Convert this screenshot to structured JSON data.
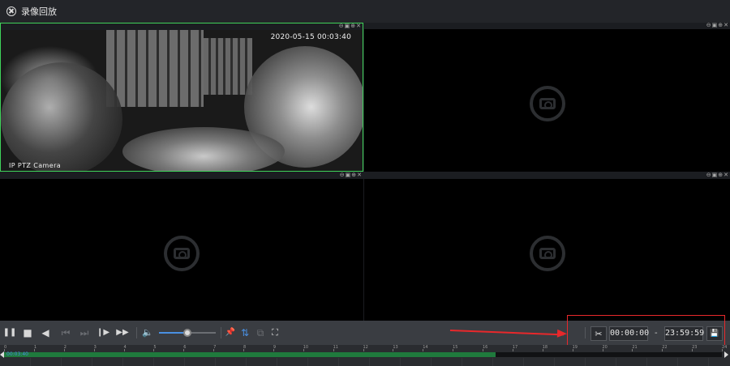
{
  "window": {
    "title": "录像回放"
  },
  "panes": [
    {
      "id": "pane-1",
      "active": true,
      "has_video": true,
      "osd_time": "2020-05-15 00:03:40",
      "osd_name": "IP PTZ Camera",
      "controls": [
        "⊖",
        "▣",
        "⊕",
        "✕"
      ]
    },
    {
      "id": "pane-2",
      "active": false,
      "has_video": false,
      "controls": [
        "⊖",
        "▣",
        "⊕",
        "✕"
      ]
    },
    {
      "id": "pane-3",
      "active": false,
      "has_video": false,
      "controls": [
        "⊖",
        "▣",
        "⊕",
        "✕"
      ]
    },
    {
      "id": "pane-4",
      "active": false,
      "has_video": false,
      "controls": [
        "⊖",
        "▣",
        "⊕",
        "✕"
      ]
    }
  ],
  "toolbar": {
    "icons": {
      "pause": "❚❚",
      "stop": "■",
      "reverse": "◀",
      "prev_frame": "⏮",
      "next_frame": "⏭",
      "step": "❙▶",
      "fast_forward": "▶▶",
      "volume": "🔈",
      "pin": "📌",
      "sync": "⇅",
      "view": "⧉",
      "fullscreen": "⛶"
    },
    "volume_level": 0.5
  },
  "clip": {
    "scissors_icon": "✂",
    "start_time": "00:00:00",
    "separator": "-",
    "end_time": "23:59:59",
    "save_icon": "💾"
  },
  "timeline": {
    "current_time": "00:03:40",
    "hour_ticks": [
      "0",
      "1",
      "2",
      "3",
      "4",
      "5",
      "6",
      "7",
      "8",
      "9",
      "10",
      "11",
      "12",
      "13",
      "14",
      "15",
      "16",
      "17",
      "18",
      "19",
      "20",
      "21",
      "22",
      "23",
      "24"
    ],
    "recorded_until_fraction": 0.685
  },
  "colors": {
    "active_border": "#3fd25a",
    "highlight_red": "#e8282b",
    "accent_blue": "#4a90e2",
    "record_green": "#1f7a3d"
  }
}
